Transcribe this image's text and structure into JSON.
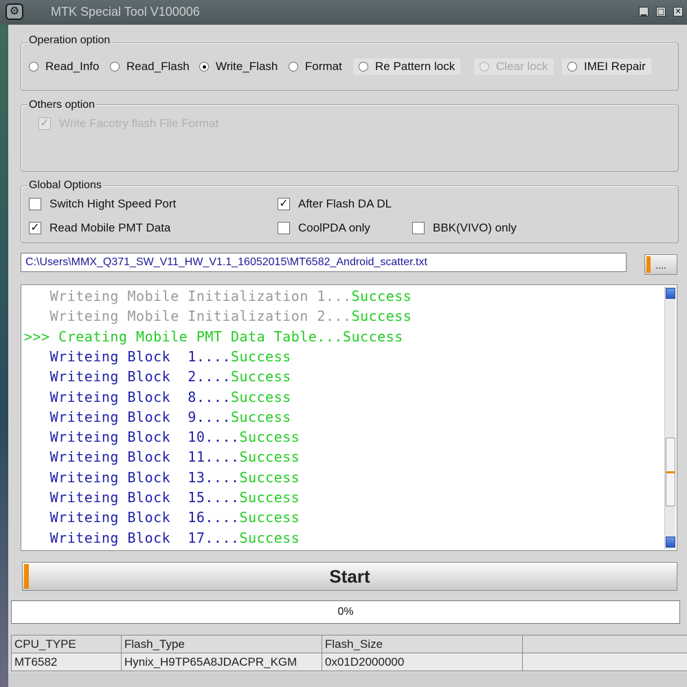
{
  "window": {
    "title": "MTK Special Tool V100006",
    "icon": "app-logo-icon",
    "controls": [
      "minimize-icon",
      "maximize-icon",
      "close-icon"
    ]
  },
  "operation_option": {
    "legend": "Operation option",
    "options": [
      {
        "label": "Read_Info",
        "selected": false,
        "enabled": true
      },
      {
        "label": "Read_Flash",
        "selected": false,
        "enabled": true
      },
      {
        "label": "Write_Flash",
        "selected": true,
        "enabled": true
      },
      {
        "label": "Format",
        "selected": false,
        "enabled": true
      },
      {
        "label": "Re Pattern lock",
        "selected": false,
        "enabled": true
      },
      {
        "label": "Clear lock",
        "selected": false,
        "enabled": false
      },
      {
        "label": "IMEI Repair",
        "selected": false,
        "enabled": true
      }
    ]
  },
  "others_option": {
    "legend": "Others option",
    "write_factory_label": "Write Facotry flash File Format",
    "write_factory_checked": true,
    "write_factory_enabled": false
  },
  "global_options": {
    "legend": "Global Options",
    "switch_speed_label": "Switch Hight Speed Port",
    "switch_speed_checked": false,
    "after_flash_label": "After Flash DA DL",
    "after_flash_checked": true,
    "read_pmt_label": "Read Mobile PMT Data",
    "read_pmt_checked": true,
    "coolpda_label": "CoolPDA only",
    "coolpda_checked": false,
    "bbk_label": "BBK(VIVO) only",
    "bbk_checked": false
  },
  "scatter": {
    "path": "C:\\Users\\MMX_Q371_SW_V11_HW_V1.1_16052015\\MT6582_Android_scatter.txt",
    "browse_label": "...."
  },
  "log": {
    "lines": [
      {
        "prefix": "   ",
        "msg": "Writeing Mobile Initialization 1...",
        "status": "Success",
        "style": "gray"
      },
      {
        "prefix": "   ",
        "msg": "Writeing Mobile Initialization 2...",
        "status": "Success",
        "style": "gray"
      },
      {
        "prefix": ">>> ",
        "msg": "Creating Mobile PMT Data Table...",
        "status": "Success",
        "style": "green"
      },
      {
        "prefix": "   ",
        "msg": "Writeing Block  1....",
        "status": "Success",
        "style": "blue"
      },
      {
        "prefix": "   ",
        "msg": "Writeing Block  2....",
        "status": "Success",
        "style": "blue"
      },
      {
        "prefix": "   ",
        "msg": "Writeing Block  8....",
        "status": "Success",
        "style": "blue"
      },
      {
        "prefix": "   ",
        "msg": "Writeing Block  9....",
        "status": "Success",
        "style": "blue"
      },
      {
        "prefix": "   ",
        "msg": "Writeing Block  10....",
        "status": "Success",
        "style": "blue"
      },
      {
        "prefix": "   ",
        "msg": "Writeing Block  11....",
        "status": "Success",
        "style": "blue"
      },
      {
        "prefix": "   ",
        "msg": "Writeing Block  13....",
        "status": "Success",
        "style": "blue"
      },
      {
        "prefix": "   ",
        "msg": "Writeing Block  15....",
        "status": "Success",
        "style": "blue"
      },
      {
        "prefix": "   ",
        "msg": "Writeing Block  16....",
        "status": "Success",
        "style": "blue"
      },
      {
        "prefix": "   ",
        "msg": "Writeing Block  17....",
        "status": "Success",
        "style": "blue"
      }
    ]
  },
  "start_button": {
    "label": "Start"
  },
  "progress": {
    "text": "0%",
    "value": 0
  },
  "info_table": {
    "headers": [
      "CPU_TYPE",
      "Flash_Type",
      "Flash_Size",
      ""
    ],
    "row": [
      "MT6582",
      "Hynix_H9TP65A8JDACPR_KGM",
      "0x01D2000000",
      ""
    ]
  },
  "colors": {
    "accent": "#f08a00",
    "success": "#22cc22",
    "log_blue": "#1f1fa8",
    "log_gray": "#9a9a9a"
  }
}
